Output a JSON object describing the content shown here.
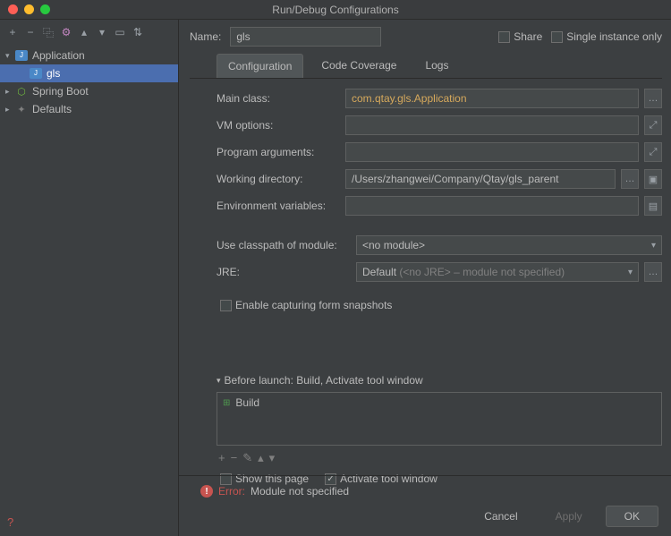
{
  "window": {
    "title": "Run/Debug Configurations"
  },
  "toolbar_icons": {
    "add": "+",
    "remove": "−",
    "copy": "⿻",
    "gear": "⚙",
    "up": "▴",
    "down": "▾",
    "folder": "▭",
    "sort": "⇅"
  },
  "tree": {
    "application": {
      "label": "Application",
      "child": "gls"
    },
    "spring": {
      "label": "Spring Boot"
    },
    "defaults": {
      "label": "Defaults"
    }
  },
  "name_row": {
    "label": "Name:",
    "value": "gls",
    "share": "Share",
    "single": "Single instance only"
  },
  "tabs": {
    "config": "Configuration",
    "coverage": "Code Coverage",
    "logs": "Logs"
  },
  "form": {
    "main_class": {
      "label": "Main class:",
      "value": "com.qtay.gls.Application"
    },
    "vm": {
      "label": "VM options:",
      "value": ""
    },
    "pargs": {
      "label": "Program arguments:",
      "value": ""
    },
    "wd": {
      "label": "Working directory:",
      "value": "/Users/zhangwei/Company/Qtay/gls_parent"
    },
    "env": {
      "label": "Environment variables:",
      "value": ""
    },
    "classpath": {
      "label": "Use classpath of module:",
      "value": "<no module>"
    },
    "jre": {
      "label": "JRE:",
      "prefix": "Default",
      "suffix": "(<no JRE> – module not specified)"
    },
    "snapshots": "Enable capturing form snapshots"
  },
  "before": {
    "header": "Before launch: Build, Activate tool window",
    "build": "Build",
    "show": "Show this page",
    "activate": "Activate tool window"
  },
  "error": {
    "label": "Error:",
    "msg": "Module not specified"
  },
  "buttons": {
    "cancel": "Cancel",
    "apply": "Apply",
    "ok": "OK"
  }
}
